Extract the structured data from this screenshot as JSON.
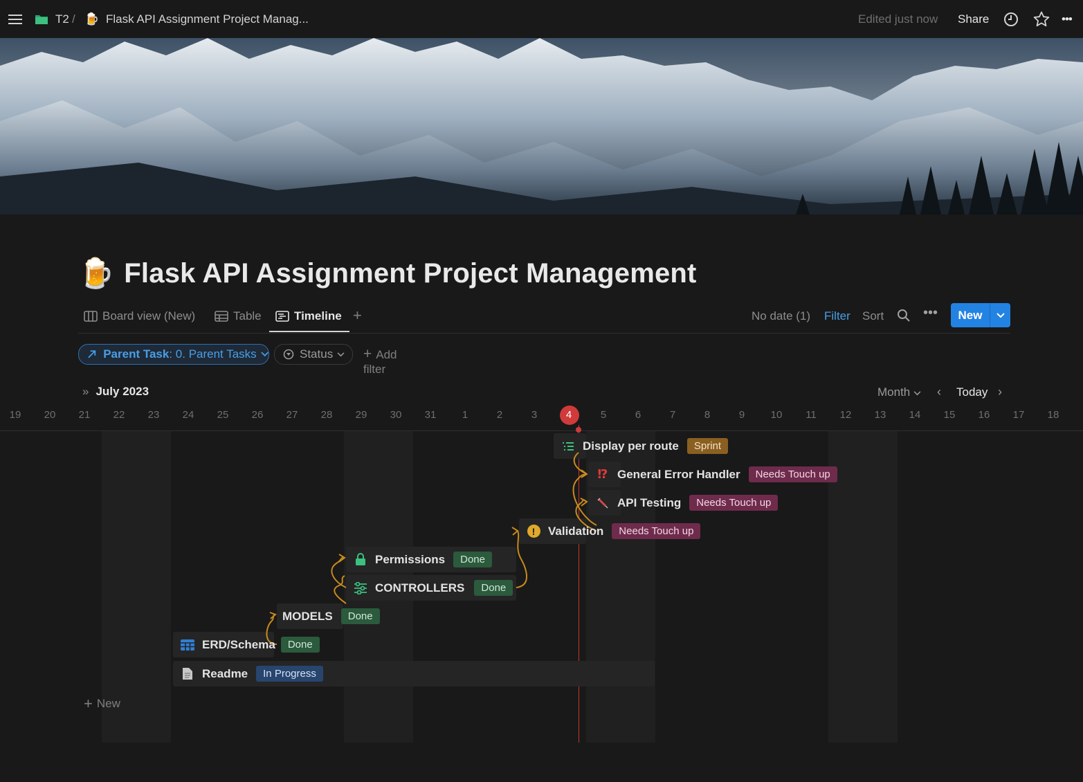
{
  "topbar": {
    "breadcrumb_workspace": "T2",
    "breadcrumb_separator": "/",
    "breadcrumb_page_icon": "🍺",
    "breadcrumb_page": "Flask API Assignment Project Manag...",
    "edited": "Edited just now",
    "share": "Share",
    "icons": [
      "menu-icon",
      "folder-icon",
      "clock-icon",
      "star-icon",
      "more-icon"
    ]
  },
  "page": {
    "icon": "🍺",
    "title": "Flask API Assignment Project Management"
  },
  "views": {
    "tabs": [
      {
        "label": "Board view (New)",
        "icon": "board-icon"
      },
      {
        "label": "Table",
        "icon": "table-icon"
      },
      {
        "label": "Timeline",
        "icon": "timeline-icon",
        "active": true
      }
    ],
    "no_date": "No date (1)",
    "filter": "Filter",
    "sort": "Sort",
    "new_button": "New"
  },
  "filters": {
    "parent_label": "Parent Task",
    "parent_value": ": 0. Parent Tasks",
    "status_label": "Status",
    "add_filter": "Add filter"
  },
  "timeline": {
    "month": "July 2023",
    "scale": "Month",
    "today_label": "Today",
    "days": [
      "19",
      "20",
      "21",
      "22",
      "23",
      "24",
      "25",
      "26",
      "27",
      "28",
      "29",
      "30",
      "31",
      "1",
      "2",
      "3",
      "4",
      "5",
      "6",
      "7",
      "8",
      "9",
      "10",
      "11",
      "12",
      "13",
      "14",
      "15",
      "16",
      "17",
      "18"
    ],
    "today": "4",
    "new_label": "New"
  },
  "tasks": [
    {
      "name": "Display per route",
      "status": "Sprint",
      "icon": "list-icon"
    },
    {
      "name": "General Error Handler",
      "status": "Needs Touch up",
      "icon": "alert-icon",
      "icon_glyph": "⁉"
    },
    {
      "name": "API Testing",
      "status": "Needs Touch up",
      "icon": "syringe-icon"
    },
    {
      "name": "Validation",
      "status": "Needs Touch up",
      "icon": "warning-icon",
      "icon_glyph": "!"
    },
    {
      "name": "Permissions",
      "status": "Done",
      "icon": "lock-icon"
    },
    {
      "name": "CONTROLLERS",
      "status": "Done",
      "icon": "sliders-icon"
    },
    {
      "name": "MODELS",
      "status": "Done"
    },
    {
      "name": "ERD/Schema",
      "status": "Done",
      "icon": "table-icon"
    },
    {
      "name": "Readme",
      "status": "In Progress",
      "icon": "document-icon"
    }
  ],
  "colors": {
    "accent": "#2383e2",
    "today": "#d03a3a",
    "dependency": "#c98a1e",
    "done": "#2b5a3c",
    "needs_touch_up": "#6e2b4c",
    "sprint": "#8a5f22",
    "in_progress": "#28456e"
  }
}
